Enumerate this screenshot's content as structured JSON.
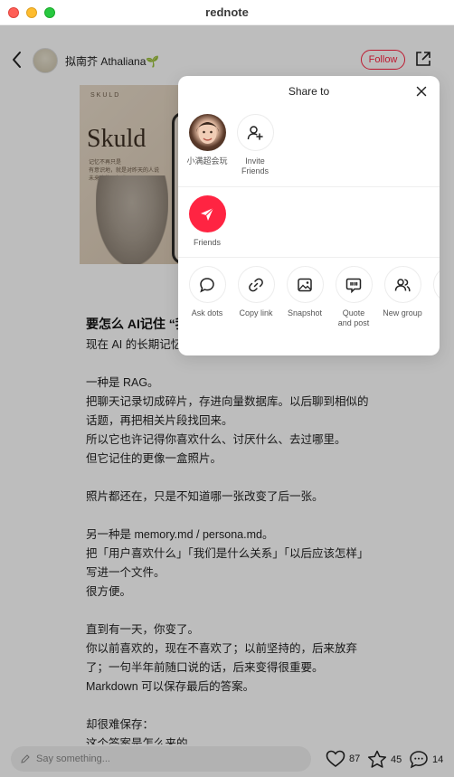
{
  "window": {
    "title": "rednote"
  },
  "author": {
    "name": "拟南芥 Athaliana🌱",
    "follow_label": "Follow"
  },
  "cover": {
    "small_text": "SKULD",
    "title": "Skuld",
    "subtitle": "记忆不再只是\n有意识地，就是对昨天的人说\n未来也能理解当下。"
  },
  "post": {
    "title": "要怎么 AI记住 “我",
    "body": "现在 AI 的长期记忆\n\n一种是 RAG。\n把聊天记录切成碎片，存进向量数据库。以后聊到相似的话题，再把相关片段找回来。\n所以它也许记得你喜欢什么、讨厌什么、去过哪里。\n但它记住的更像一盒照片。\n\n照片都还在，只是不知道哪一张改变了后一张。\n\n另一种是 memory.md / persona.md。\n把「用户喜欢什么」「我们是什么关系」「以后应该怎样」写进一个文件。\n很方便。\n\n直到有一天，你变了。\n你以前喜欢的，现在不喜欢了；以前坚持的，后来放弃了；一句半年前随口说的话，后来变得很重要。\nMarkdown 可以保存最后的答案。\n\n却很难保存：\n这个答案是怎么来的。"
  },
  "bottom": {
    "input_placeholder": "Say something...",
    "likes": "87",
    "stars": "45",
    "comments": "14"
  },
  "share": {
    "title": "Share to",
    "contacts": [
      {
        "label": "小满超会玩",
        "icon": "user-avatar-photo"
      },
      {
        "label": "Invite\nFriends",
        "icon": "add-user-icon"
      }
    ],
    "friends": {
      "label": "Friends",
      "icon": "paper-plane-icon"
    },
    "actions": [
      {
        "label": "Ask dots",
        "icon": "chat-bubble-icon"
      },
      {
        "label": "Copy link",
        "icon": "link-icon"
      },
      {
        "label": "Snapshot",
        "icon": "image-icon"
      },
      {
        "label": "Quote\nand post",
        "icon": "quote-icon"
      },
      {
        "label": "New group",
        "icon": "group-icon"
      }
    ]
  },
  "colors": {
    "accent": "#ff2442",
    "overlay": "rgba(0,0,0,0.26)"
  }
}
